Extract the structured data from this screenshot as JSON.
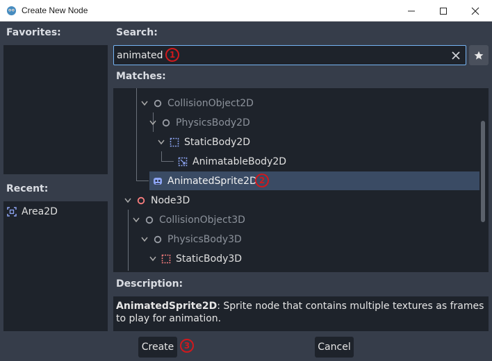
{
  "window": {
    "title": "Create New Node"
  },
  "favorites": {
    "label": "Favorites:"
  },
  "recent": {
    "label": "Recent:",
    "items": [
      {
        "label": "Area2D",
        "icon": "area2d-icon"
      }
    ]
  },
  "search": {
    "label": "Search:",
    "value": "animated"
  },
  "matches": {
    "label": "Matches:",
    "items": [
      {
        "label": "CollisionObject2D",
        "dim": true
      },
      {
        "label": "PhysicsBody2D",
        "dim": true
      },
      {
        "label": "StaticBody2D",
        "dim": false
      },
      {
        "label": "AnimatableBody2D",
        "dim": false
      },
      {
        "label": "AnimatedSprite2D",
        "dim": false,
        "selected": true
      },
      {
        "label": "Node3D",
        "dim": false
      },
      {
        "label": "CollisionObject3D",
        "dim": true
      },
      {
        "label": "PhysicsBody3D",
        "dim": true
      },
      {
        "label": "StaticBody3D",
        "dim": false
      }
    ]
  },
  "description": {
    "label": "Description:",
    "node_name": "AnimatedSprite2D",
    "text": ": Sprite node that contains multiple textures as frames to play for animation."
  },
  "buttons": {
    "create": "Create",
    "cancel": "Cancel"
  },
  "markers": [
    "1",
    "2",
    "3"
  ],
  "colors": {
    "accent": "#77b5f4",
    "selected_row": "#3a4b64",
    "marker": "#d0191d",
    "node2d": "#8da5f3",
    "node3d": "#fc7f7f"
  }
}
